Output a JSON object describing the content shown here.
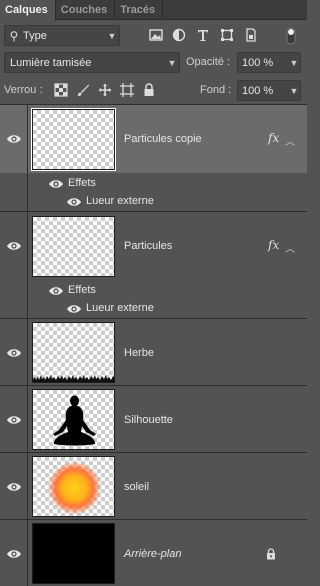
{
  "tabs": [
    {
      "label": "Calques",
      "active": true
    },
    {
      "label": "Couches",
      "active": false
    },
    {
      "label": "Tracés",
      "active": false
    }
  ],
  "filter": {
    "kind_label": "Type",
    "icons": [
      "image-filter-icon",
      "adjustment-filter-icon",
      "type-filter-icon",
      "shape-filter-icon",
      "smart-object-filter-icon"
    ]
  },
  "blend": {
    "mode": "Lumière tamisée",
    "opacity_label": "Opacité :",
    "opacity_value": "100 %"
  },
  "lock": {
    "label": "Verrou :",
    "icons": [
      "lock-transparency-icon",
      "lock-pixels-icon",
      "lock-position-icon",
      "lock-artboard-icon",
      "lock-all-icon"
    ],
    "fill_label": "Fond :",
    "fill_value": "100 %"
  },
  "layers": [
    {
      "name": "Particules copie",
      "selected": true,
      "has_fx": true,
      "effects_label": "Effets",
      "effect": "Lueur externe",
      "thumb": "transparent"
    },
    {
      "name": "Particules",
      "selected": false,
      "has_fx": true,
      "effects_label": "Effets",
      "effect": "Lueur externe",
      "thumb": "transparent"
    },
    {
      "name": "Herbe",
      "selected": false,
      "has_fx": false,
      "thumb": "grass"
    },
    {
      "name": "Silhouette",
      "selected": false,
      "has_fx": false,
      "thumb": "silhouette"
    },
    {
      "name": "soleil",
      "selected": false,
      "has_fx": false,
      "thumb": "sun"
    },
    {
      "name": "Arrière-plan",
      "selected": false,
      "has_fx": false,
      "thumb": "black",
      "locked": true
    }
  ],
  "fx_glyph": "fx",
  "colors": {
    "panel": "#535353",
    "selected": "#6b6b6b",
    "sun_center": "#ffd21a",
    "sun_edge": "#ff6a2a"
  }
}
